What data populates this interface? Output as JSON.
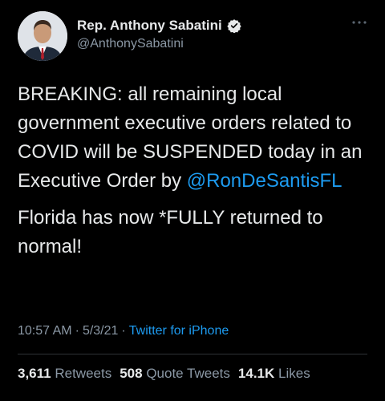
{
  "author": {
    "display_name": "Rep. Anthony Sabatini",
    "handle": "@AnthonySabatini",
    "verified": true,
    "avatar_icon": "profile-photo"
  },
  "tweet": {
    "text_part1": "BREAKING: all remaining local government executive orders related to COVID will be SUSPENDED today in an Executive Order by ",
    "mention": "@RonDeSantisFL",
    "text_part2": "Florida has now *FULLY returned to normal!"
  },
  "meta": {
    "time": "10:57 AM",
    "date": "5/3/21",
    "separator": "·",
    "source": "Twitter for iPhone"
  },
  "stats": {
    "retweets": {
      "count": "3,611",
      "label": "Retweets"
    },
    "quote_tweets": {
      "count": "508",
      "label": "Quote Tweets"
    },
    "likes": {
      "count": "14.1K",
      "label": "Likes"
    }
  },
  "colors": {
    "background": "#000000",
    "text": "#e7e9ea",
    "secondary": "#8b98a5",
    "link": "#1d9bf0"
  }
}
